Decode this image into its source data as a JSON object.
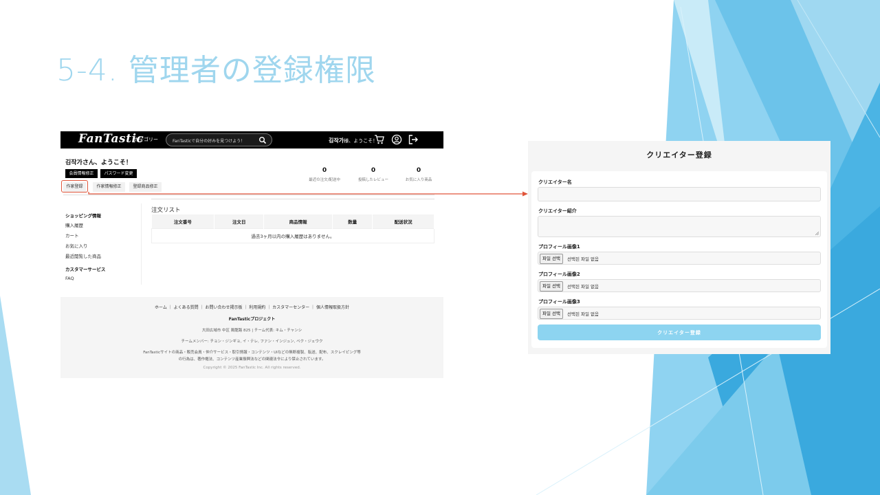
{
  "slide": {
    "title": "5-4. 管理者の登録権限"
  },
  "left_page": {
    "header": {
      "logo": "FanTastic",
      "category": "カテゴリー",
      "search_placeholder": "FanTasticで自分の好みを見つけよう！",
      "user_name": "김작가",
      "user_suffix": "様、ようこそ！"
    },
    "greeting": "김작가さん、ようこそ！",
    "buttons": {
      "member_edit": "会員情報修正",
      "password_change": "パスワード変更"
    },
    "tabs": [
      "作家登録",
      "作家情報修正",
      "登録商品修正"
    ],
    "stats": [
      {
        "value": "0",
        "label": "最近の注文/配送中"
      },
      {
        "value": "0",
        "label": "投稿したレビュー"
      },
      {
        "value": "0",
        "label": "お気に入り商品"
      }
    ],
    "sidebar": {
      "shopping_heading": "ショッピング情報",
      "shopping_items": [
        "購入履歴",
        "カート",
        "お気に入り",
        "最近閲覧した商品"
      ],
      "service_heading": "カスタマーサービス",
      "service_items": [
        "FAQ"
      ]
    },
    "order_list": {
      "title": "注文リスト",
      "columns": [
        "注文番号",
        "注文日",
        "商品情報",
        "数量",
        "配送状況"
      ],
      "empty_message": "過去3ヶ月以内の購入履歴はありません。"
    },
    "footer": {
      "links": "ホーム ｜ よくある質問 ｜ お問い合わせ掲示板 ｜ 利用規約 ｜ カスタマーセンター ｜ 個人情報取扱方針",
      "project": "FanTasticプロジェクト",
      "address": "大田広域市 中区 鶏龍路 825 | チーム代表: キム・チャンシ",
      "members": "チームメンバー: チョン・ジンギョ, イ・テレ, ファン・インジュン, ベク・ジェウク",
      "notice_1": "FanTasticサイトの商品・販売会員・仲介サービス・取引情報・コンテンツ・UIなどの無断複製、転送、配布、スクレイピング等",
      "notice_2": "の行為は、著作権法、コンテンツ産業振興法などの関連法令により禁止されています。",
      "copyright": "Copyright © 2025 FanTastic Inc. All rights reserved."
    }
  },
  "right_page": {
    "title": "クリエイター登録",
    "fields": {
      "name_label": "クリエイター名",
      "intro_label": "クリエイター紹介",
      "images": [
        {
          "label": "プロフィール画像1",
          "button": "파일 선택",
          "status": "선택된 파일 없음"
        },
        {
          "label": "プロフィール画像2",
          "button": "파일 선택",
          "status": "선택된 파일 없음"
        },
        {
          "label": "プロフィール画像3",
          "button": "파일 선택",
          "status": "선택된 파일 없음"
        }
      ]
    },
    "submit": "クリエイター登録"
  },
  "colors": {
    "title": "#9fd6ee",
    "accent_blue": "#8dd4f0",
    "highlight": "#e0553a",
    "header_bg": "#000000"
  }
}
